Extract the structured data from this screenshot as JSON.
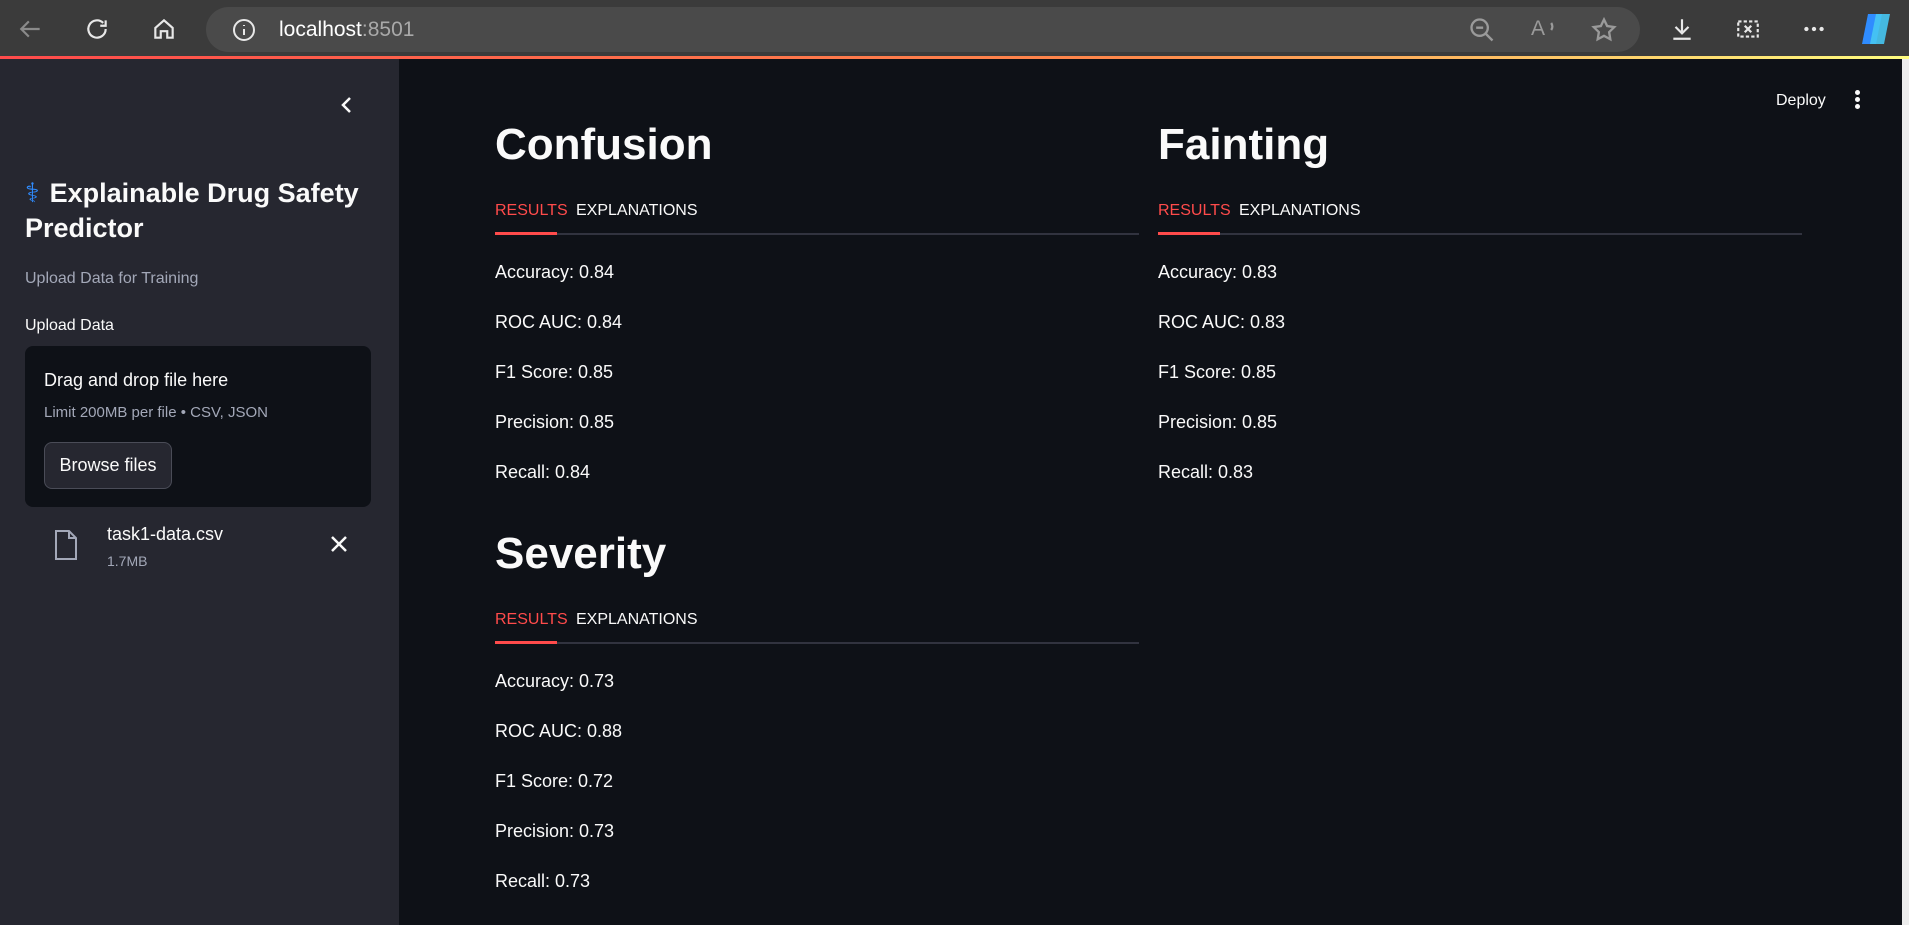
{
  "browser": {
    "url_host": "localhost",
    "url_port": ":8501"
  },
  "sidebar": {
    "title_emoji": "⚕",
    "title": "Explainable Drug Safety Predictor",
    "caption": "Upload Data for Training",
    "upload_label": "Upload Data",
    "dropzone": {
      "text": "Drag and drop file here",
      "limit": "Limit 200MB per file • CSV, JSON",
      "browse_label": "Browse files"
    },
    "file": {
      "name": "task1-data.csv",
      "size": "1.7MB"
    }
  },
  "header": {
    "deploy_label": "Deploy"
  },
  "sections": [
    {
      "title": "Confusion",
      "tabs": [
        "RESULTS",
        "EXPLANATIONS"
      ],
      "metrics": [
        "Accuracy: 0.84",
        "ROC AUC: 0.84",
        "F1 Score: 0.85",
        "Precision: 0.85",
        "Recall: 0.84"
      ]
    },
    {
      "title": "Fainting",
      "tabs": [
        "RESULTS",
        "EXPLANATIONS"
      ],
      "metrics": [
        "Accuracy: 0.83",
        "ROC AUC: 0.83",
        "F1 Score: 0.85",
        "Precision: 0.85",
        "Recall: 0.83"
      ]
    },
    {
      "title": "Severity",
      "tabs": [
        "RESULTS",
        "EXPLANATIONS"
      ],
      "metrics": [
        "Accuracy: 0.73",
        "ROC AUC: 0.88",
        "F1 Score: 0.72",
        "Precision: 0.73",
        "Recall: 0.73"
      ]
    }
  ],
  "colors": {
    "accent": "#ff4b4b",
    "sidebar_bg": "#262730",
    "main_bg": "#0e1117"
  }
}
